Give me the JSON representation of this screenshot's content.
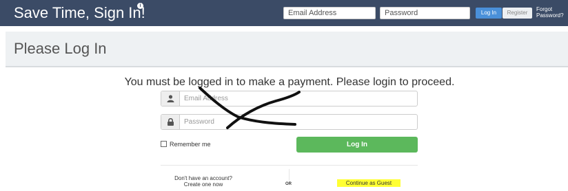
{
  "topbar": {
    "brand": "Save Time, Sign In!",
    "info_badge": "i",
    "email_placeholder": "Email Address",
    "password_placeholder": "Password",
    "login_label": "Log In",
    "register_label": "Register",
    "forgot_label": "Forgot Password?"
  },
  "page": {
    "title": "Please Log In",
    "message": "You must be logged in to make a payment. Please login to proceed."
  },
  "form": {
    "email_placeholder": "Email Address",
    "password_placeholder": "Password",
    "remember_label": "Remember me",
    "login_label": "Log In"
  },
  "footer": {
    "no_account": "Don't have an account?",
    "create_one": "Create one now",
    "or_label": "OR",
    "guest_label": "Continue as Guest"
  },
  "icons": {
    "email": "user-icon",
    "password": "lock-icon"
  },
  "colors": {
    "topbar": "#3b4b66",
    "primary": "#4a90d9",
    "success": "#5cb85c",
    "highlight": "#ffff33"
  }
}
